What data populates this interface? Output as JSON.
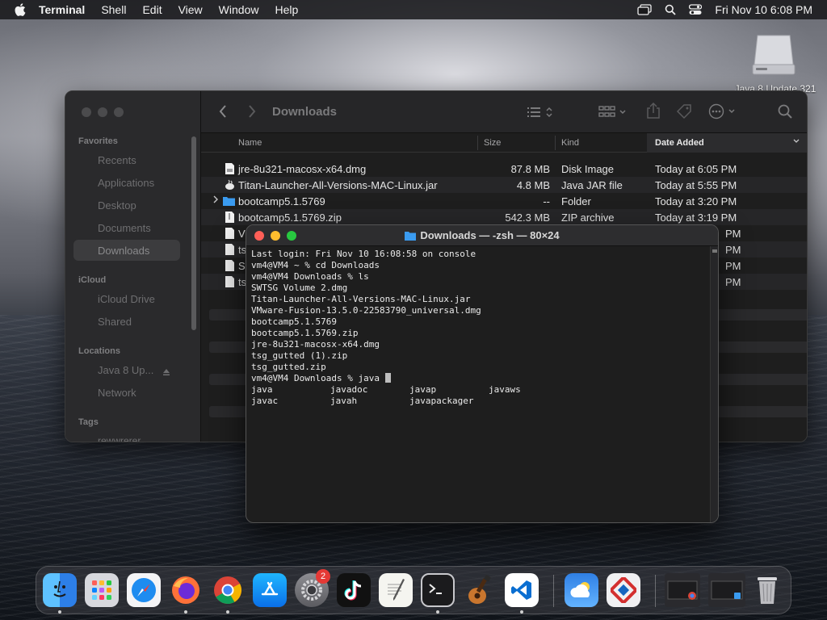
{
  "menubar": {
    "app_name": "Terminal",
    "items": [
      "Shell",
      "Edit",
      "View",
      "Window",
      "Help"
    ],
    "datetime": "Fri Nov 10  6:08 PM"
  },
  "desktop": {
    "disk_label": "Java 8 Update 321"
  },
  "finder": {
    "folder_title": "Downloads",
    "sidebar": {
      "favorites_header": "Favorites",
      "favorites": [
        "Recents",
        "Applications",
        "Desktop",
        "Documents",
        "Downloads"
      ],
      "icloud_header": "iCloud",
      "icloud": [
        "iCloud Drive",
        "Shared"
      ],
      "locations_header": "Locations",
      "locations": [
        "Java 8 Up...",
        "Network"
      ],
      "tags_header": "Tags",
      "tags": [
        "rewwrerer"
      ]
    },
    "columns": {
      "name": "Name",
      "size": "Size",
      "kind": "Kind",
      "date": "Date Added"
    },
    "rows": [
      {
        "name": "jre-8u321-macosx-x64.dmg",
        "size": "87.8 MB",
        "kind": "Disk Image",
        "date": "Today at 6:05 PM"
      },
      {
        "name": "Titan-Launcher-All-Versions-MAC-Linux.jar",
        "size": "4.8 MB",
        "kind": "Java JAR file",
        "date": "Today at 5:55 PM"
      },
      {
        "name": "bootcamp5.1.5769",
        "size": "--",
        "kind": "Folder",
        "date": "Today at 3:20 PM"
      },
      {
        "name": "bootcamp5.1.5769.zip",
        "size": "542.3 MB",
        "kind": "ZIP archive",
        "date": "Today at 3:19 PM"
      }
    ],
    "hidden_rows": [
      {
        "name": "V",
        "date": "PM"
      },
      {
        "name": "ts",
        "date": "PM"
      },
      {
        "name": "S",
        "date": "PM"
      },
      {
        "name": "ts",
        "date": "PM"
      }
    ]
  },
  "terminal": {
    "title": "Downloads — -zsh — 80×24",
    "lines": [
      "Last login: Fri Nov 10 16:08:58 on console",
      "vm4@VM4 ~ % cd Downloads",
      "vm4@VM4 Downloads % ls",
      "SWTSG Volume 2.dmg",
      "Titan-Launcher-All-Versions-MAC-Linux.jar",
      "VMware-Fusion-13.5.0-22583790_universal.dmg",
      "bootcamp5.1.5769",
      "bootcamp5.1.5769.zip",
      "jre-8u321-macosx-x64.dmg",
      "tsg_gutted (1).zip",
      "tsg_gutted.zip"
    ],
    "prompt": "vm4@VM4 Downloads % java ",
    "completions": [
      [
        "java",
        "javadoc",
        "javap",
        "javaws"
      ],
      [
        "javac",
        "javah",
        "javapackager"
      ]
    ]
  },
  "dock": {
    "settings_badge": "2",
    "apps": [
      "finder-icon",
      "launchpad-icon",
      "safari-icon",
      "firefox-icon",
      "chrome-icon",
      "app-store-icon",
      "system-settings-icon",
      "tiktok-icon",
      "textedit-icon",
      "terminal-icon",
      "garageband-icon",
      "vscode-icon",
      "weather-icon",
      "parallels-icon",
      "trash-icon"
    ]
  },
  "colors": {
    "close": "#ff5f57",
    "minimize": "#febc2e",
    "zoom": "#28c840",
    "folder_blue": "#3a9bf0",
    "accent": "#0a84ff"
  }
}
